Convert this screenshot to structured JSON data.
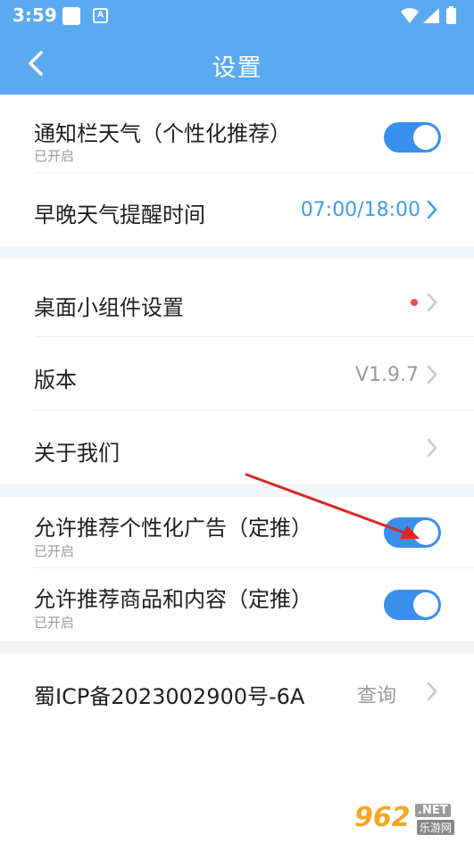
{
  "status_bar": {
    "time": "3:59",
    "notif_letter": "A"
  },
  "header": {
    "title": "设置",
    "back_icon": "chevron-left-icon"
  },
  "colors": {
    "primary": "#5aa9f0",
    "toggle_on": "#3b8fec",
    "value_blue": "#3c9ee8",
    "red_dot": "#f2484b",
    "gap": "#f3f4f6"
  },
  "sections": {
    "notify": {
      "title": "通知栏天气（个性化推荐）",
      "status": "已开启",
      "enabled": true
    },
    "reminder": {
      "title": "早晚天气提醒时间",
      "value": "07:00/18:00"
    },
    "widget": {
      "title": "桌面小组件设置",
      "has_badge": true
    },
    "version": {
      "title": "版本",
      "value": "V1.9.7"
    },
    "about": {
      "title": "关于我们"
    },
    "ads": {
      "title": "允许推荐个性化广告（定推）",
      "status": "已开启",
      "enabled": true
    },
    "products": {
      "title": "允许推荐商品和内容（定推）",
      "status": "已开启",
      "enabled": true
    },
    "icp": {
      "title": "蜀ICP备2023002900号-6A",
      "action": "查询"
    }
  },
  "watermark": {
    "logo": "962",
    "net": ".NET",
    "sub": "乐游网"
  }
}
